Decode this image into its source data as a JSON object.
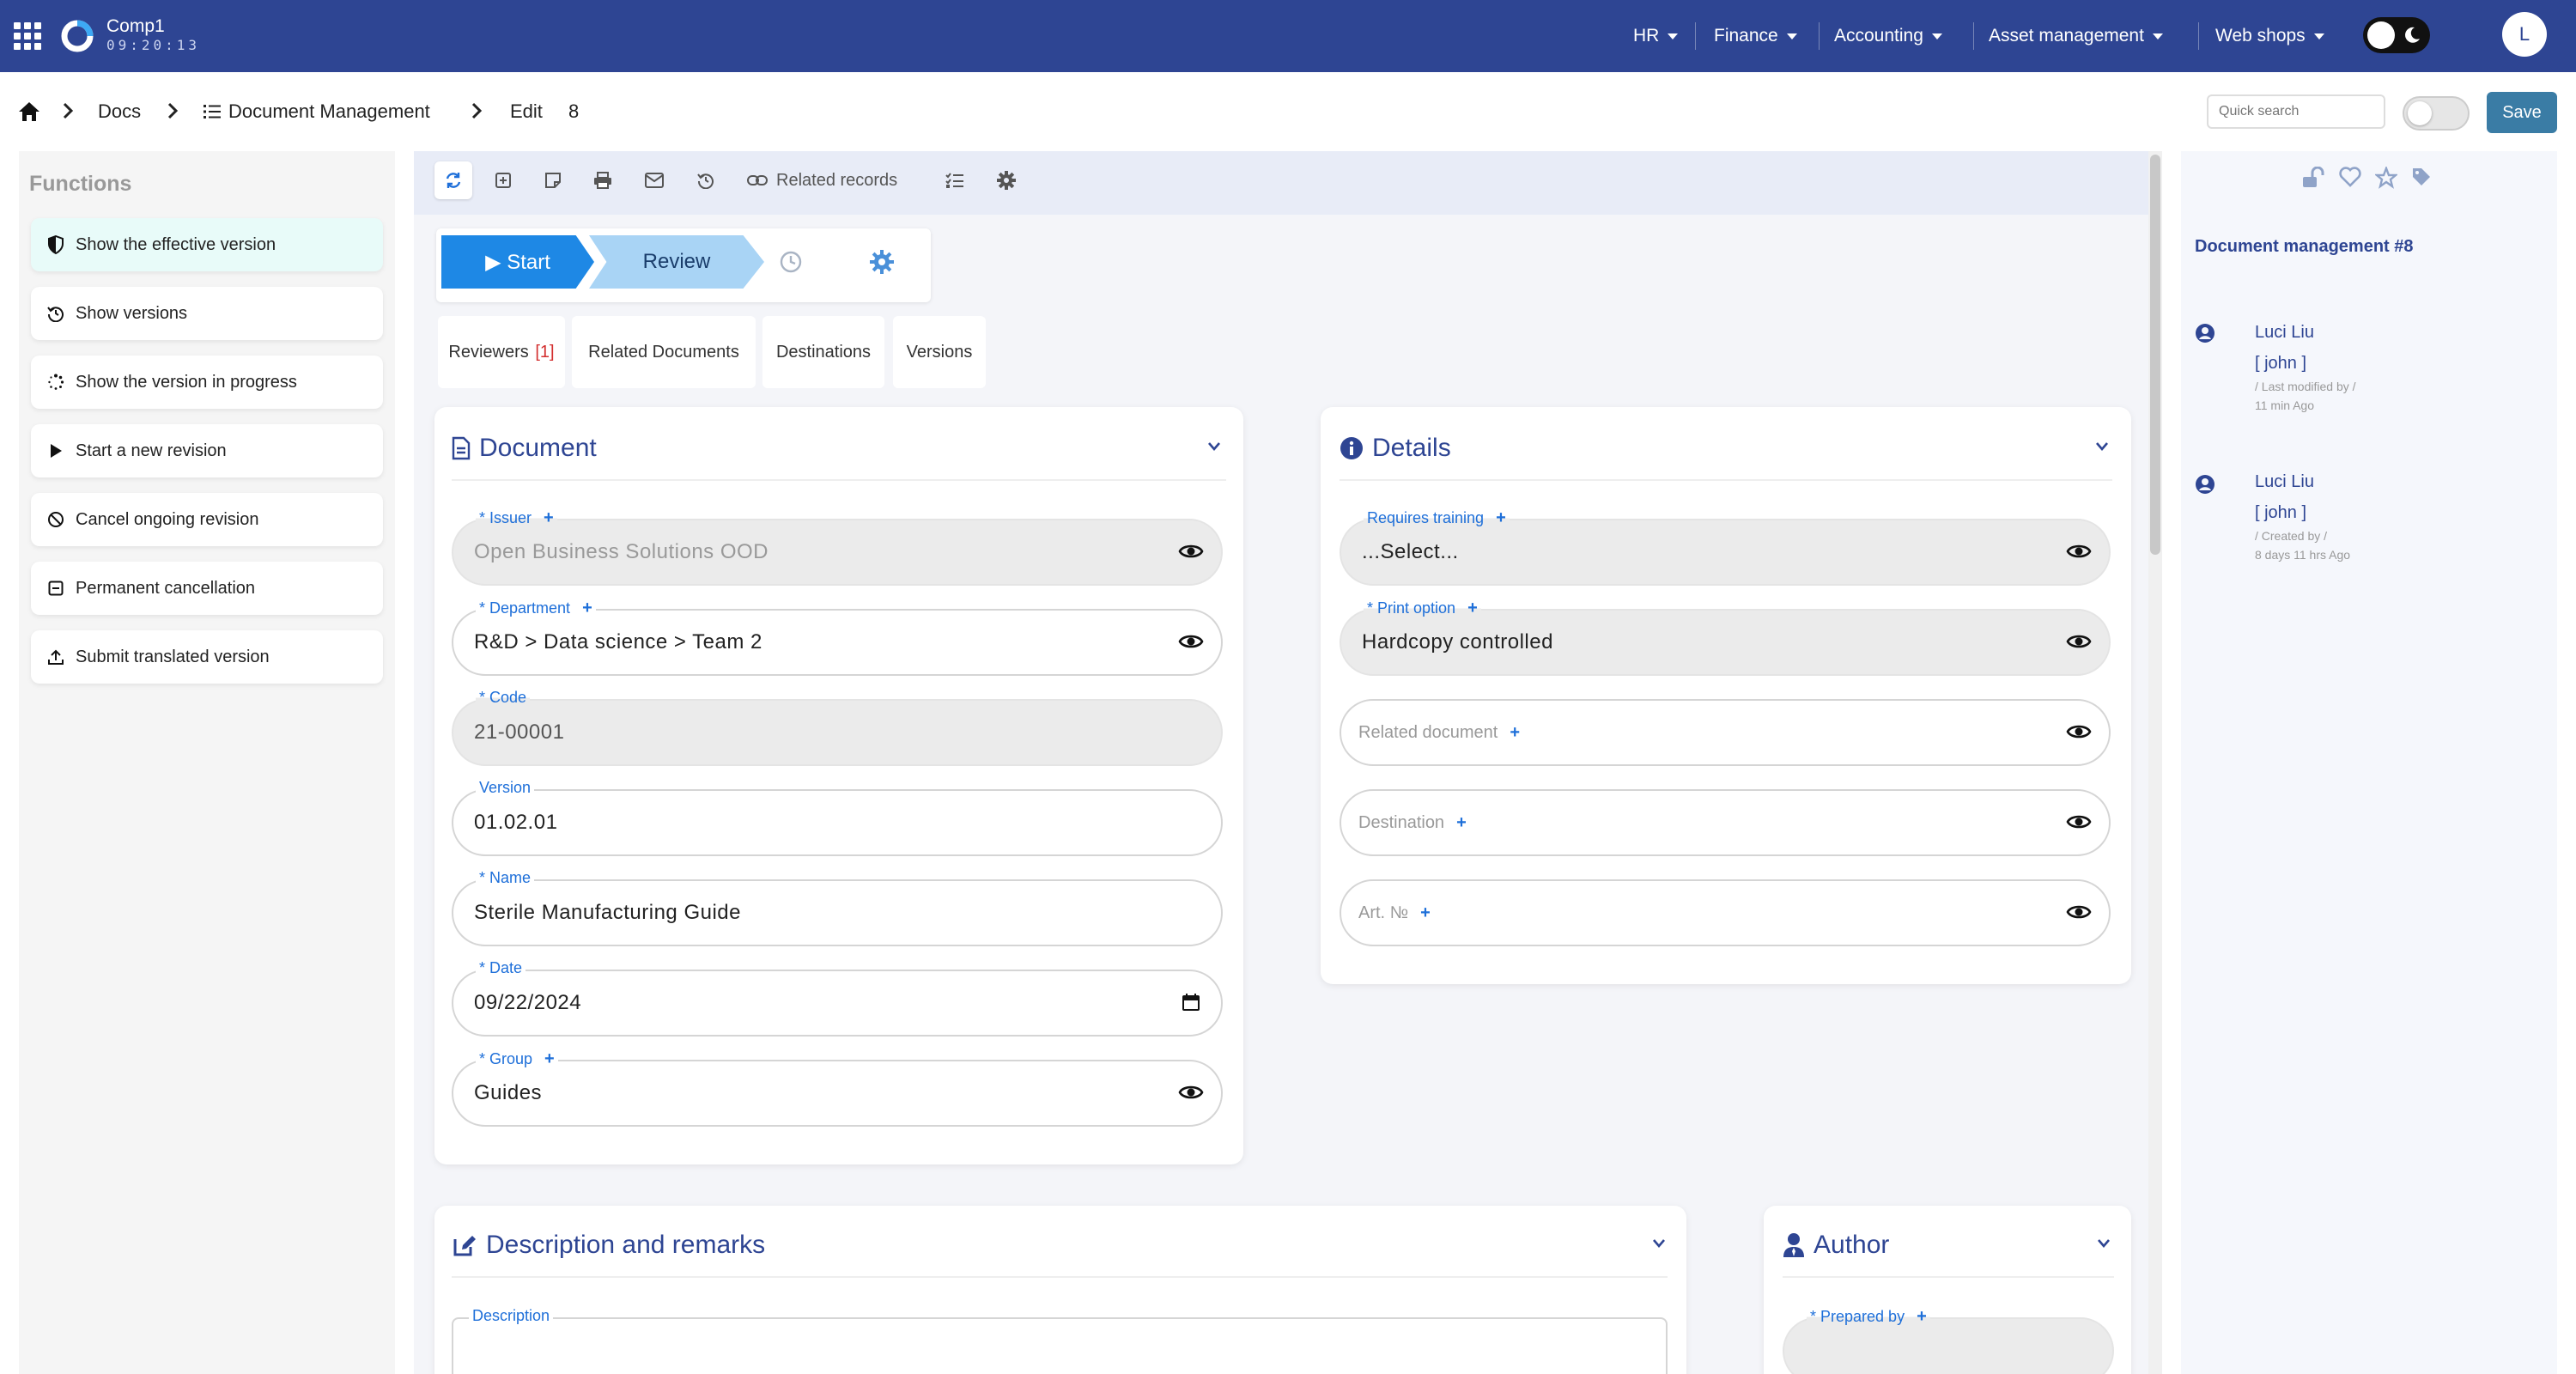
{
  "topbar": {
    "company": "Comp1",
    "clock": "09:20:13",
    "menus": [
      "HR",
      "Finance",
      "Accounting",
      "Asset management",
      "Web shops"
    ],
    "avatar_letter": "L",
    "bg_color": "#2e4593"
  },
  "breadcrumb": {
    "docs": "Docs",
    "module": "Document Management",
    "action": "Edit",
    "record_id": "8"
  },
  "header": {
    "search_placeholder": "Quick search",
    "save_label": "Save"
  },
  "functions": {
    "title": "Functions",
    "items": [
      {
        "label": "Show the effective version",
        "icon": "shield-half-icon"
      },
      {
        "label": "Show versions",
        "icon": "history-icon"
      },
      {
        "label": "Show the version in progress",
        "icon": "spinner-icon"
      },
      {
        "label": "Start a new revision",
        "icon": "play-icon"
      },
      {
        "label": "Cancel ongoing revision",
        "icon": "ban-icon"
      },
      {
        "label": "Permanent cancellation",
        "icon": "minus-square-icon"
      },
      {
        "label": "Submit translated version",
        "icon": "upload-icon"
      }
    ]
  },
  "toolbar": {
    "related_records": "Related records"
  },
  "workflow": {
    "start": "▶ Start",
    "review": "Review"
  },
  "tabs": [
    {
      "label": "Reviewers",
      "count": "[1]"
    },
    {
      "label": "Related Documents"
    },
    {
      "label": "Destinations"
    },
    {
      "label": "Versions"
    }
  ],
  "document_card": {
    "title": "Document",
    "fields": {
      "issuer": {
        "label": "* Issuer",
        "value": "Open Business Solutions OOD"
      },
      "department": {
        "label": "* Department",
        "value": "R&D > Data science > Team 2"
      },
      "code": {
        "label": "* Code",
        "value": "21-00001"
      },
      "version": {
        "label": "Version",
        "value": "01.02.01"
      },
      "name": {
        "label": "* Name",
        "value": "Sterile Manufacturing Guide"
      },
      "date": {
        "label": "* Date",
        "value": "09/22/2024"
      },
      "group": {
        "label": "* Group",
        "value": "Guides"
      }
    }
  },
  "details_card": {
    "title": "Details",
    "fields": {
      "requires_training": {
        "label": "Requires training",
        "value": "...Select..."
      },
      "print_option": {
        "label": "* Print option",
        "value": "Hardcopy controlled"
      },
      "related_document": {
        "placeholder": "Related document"
      },
      "destination": {
        "placeholder": "Destination"
      },
      "art_no": {
        "placeholder": "Art. №"
      }
    }
  },
  "description_card": {
    "title": "Description and remarks",
    "description_label": "Description"
  },
  "author_card": {
    "title": "Author",
    "prepared_by_label": "* Prepared by"
  },
  "right_panel": {
    "title": "Document management #8",
    "activity": [
      {
        "user": "Luci Liu",
        "handle": "[ john ]",
        "action": "/ Last modified by /",
        "time": "11 min Ago"
      },
      {
        "user": "Luci Liu",
        "handle": "[ john ]",
        "action": "/ Created by /",
        "time": "8 days 11 hrs Ago"
      }
    ]
  },
  "plus_sign": "+"
}
